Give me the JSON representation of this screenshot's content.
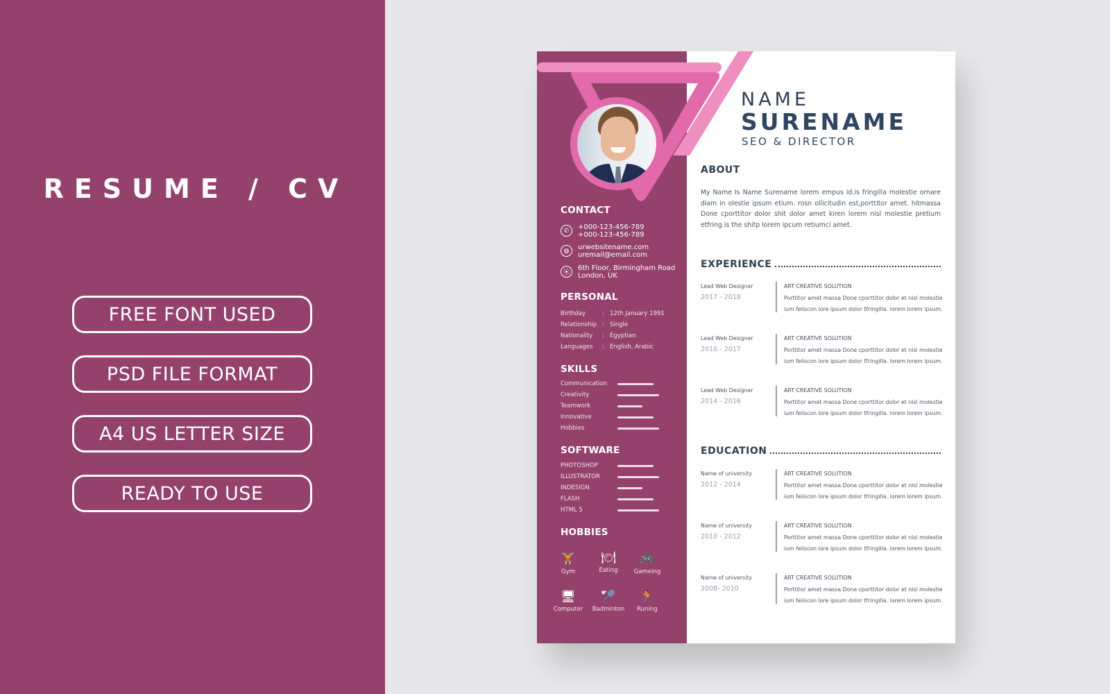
{
  "promo": {
    "title": "RESUME / CV",
    "features": [
      "FREE FONT USED",
      "PSD FILE FORMAT",
      "A4 US LETTER SIZE",
      "READY TO USE"
    ],
    "background_color": "#94426b"
  },
  "resume": {
    "colors": {
      "sidebar": "#94426b",
      "accent_pink": "#e26aaa",
      "light_pink": "#ef8fbf",
      "heading": "#2f3f55"
    },
    "name_first": "NAME",
    "name_last": "SURENAME",
    "role": "SEO & DIRECTOR",
    "contact": {
      "heading": "CONTACT",
      "items": [
        {
          "icon": "phone-icon",
          "lines": [
            "+000-123-456-789",
            "+000-123-456-789"
          ]
        },
        {
          "icon": "globe-icon",
          "lines": [
            "urwebsitename.com",
            "uremail@email.com"
          ]
        },
        {
          "icon": "location-pin-icon",
          "lines": [
            "6th Floor, Birmingham Road",
            "London, UK"
          ]
        }
      ]
    },
    "personal": {
      "heading": "PERSONAL",
      "separator": ":",
      "items": [
        {
          "key": "Birthday",
          "value": "12th January 1991"
        },
        {
          "key": "Relationship",
          "value": "Single"
        },
        {
          "key": "Nationality",
          "value": "Egyptian"
        },
        {
          "key": "Languages",
          "value": "English, Arabic"
        }
      ]
    },
    "skills": {
      "heading": "SKILLS",
      "items": [
        {
          "label": "Communication",
          "level": 0.87
        },
        {
          "label": "Creativity",
          "level": 1.0
        },
        {
          "label": "Teamwork",
          "level": 0.6
        },
        {
          "label": "Innovative",
          "level": 0.87
        },
        {
          "label": "Hobbies",
          "level": 1.0
        }
      ]
    },
    "software": {
      "heading": "SOFTWARE",
      "items": [
        {
          "label": "PHOTOSHOP",
          "level": 0.87
        },
        {
          "label": "ILLUSTRATOR",
          "level": 1.0
        },
        {
          "label": "INDESIGN",
          "level": 0.6
        },
        {
          "label": "FLASH",
          "level": 0.87
        },
        {
          "label": "HTML 5",
          "level": 1.0
        }
      ]
    },
    "hobbies": {
      "heading": "HOBBIES",
      "items": [
        {
          "icon": "dumbbell-icon",
          "glyph": "🏋",
          "label": "Gym"
        },
        {
          "icon": "dining-icon",
          "glyph": "🍽",
          "label": "Eating"
        },
        {
          "icon": "gamepad-icon",
          "glyph": "🎮",
          "label": "Gameing"
        },
        {
          "icon": "computer-icon",
          "glyph": "🖥",
          "label": "Computer"
        },
        {
          "icon": "badminton-icon",
          "glyph": "🏸",
          "label": "Badminton"
        },
        {
          "icon": "running-icon",
          "glyph": "🏃",
          "label": "Runing"
        }
      ]
    },
    "about": {
      "heading": "ABOUT",
      "text": "My Name Is Name  Surename lorem empus id.is fringilla molestie ornare diam in olestie ipsum etium. rosn ollicitudin est,porttitor amet. hitmassa Done cporttitor dolor shit dolor amet kiren lorem nisl molestie pretium etfring.is the shitp lorem ipcum retiumci amet."
    },
    "experience": {
      "heading": "EXPERIENCE",
      "items": [
        {
          "title": "Lead  Web Designer",
          "years": "2017 - 2018",
          "company": "ART CREATIVE SOLUTION",
          "desc1": "Porttitor amet massa Done cporttitor dolor et nisl molestie",
          "desc2": "ium feliscon lore  ipsum dolor tfringilla. lorem lorem ipsum."
        },
        {
          "title": "Lead  Web Designer",
          "years": "2016 - 2017",
          "company": "ART CREATIVE SOLUTION",
          "desc1": "Porttitor amet massa Done cporttitor dolor et nisl molestie",
          "desc2": "ium feliscon lore  ipsum dolor tfringilla. lorem lorem ipsum."
        },
        {
          "title": "Lead  Web Designer",
          "years": "2014 - 2016",
          "company": "ART CREATIVE SOLUTION",
          "desc1": "Porttitor amet massa Done cporttitor dolor et nisl molestie",
          "desc2": "ium feliscon lore  ipsum dolor tfringilla. lorem lorem ipsum."
        }
      ]
    },
    "education": {
      "heading": "EDUCATION",
      "items": [
        {
          "title": "Name of university",
          "years": "2012 - 2014",
          "company": "ART CREATIVE SOLUTION",
          "desc1": "Porttitor amet massa Done cporttitor dolor et nisl molestie",
          "desc2": "ium feliscon lore  ipsum dolor tfringilla. lorem lorem ipsum."
        },
        {
          "title": "Name of university",
          "years": "2010 - 2012",
          "company": "ART CREATIVE SOLUTION",
          "desc1": "Porttitor amet massa Done cporttitor dolor et nisl molestie",
          "desc2": "ium feliscon lore  ipsum dolor tfringilla. lorem lorem ipsum."
        },
        {
          "title": "Name of university",
          "years": "2008- 2010",
          "company": "ART CREATIVE SOLUTION",
          "desc1": "Porttitor amet massa Done cporttitor dolor et nisl molestie",
          "desc2": "ium feliscon lore  ipsum dolor tfringilla. lorem lorem ipsum."
        }
      ]
    }
  }
}
